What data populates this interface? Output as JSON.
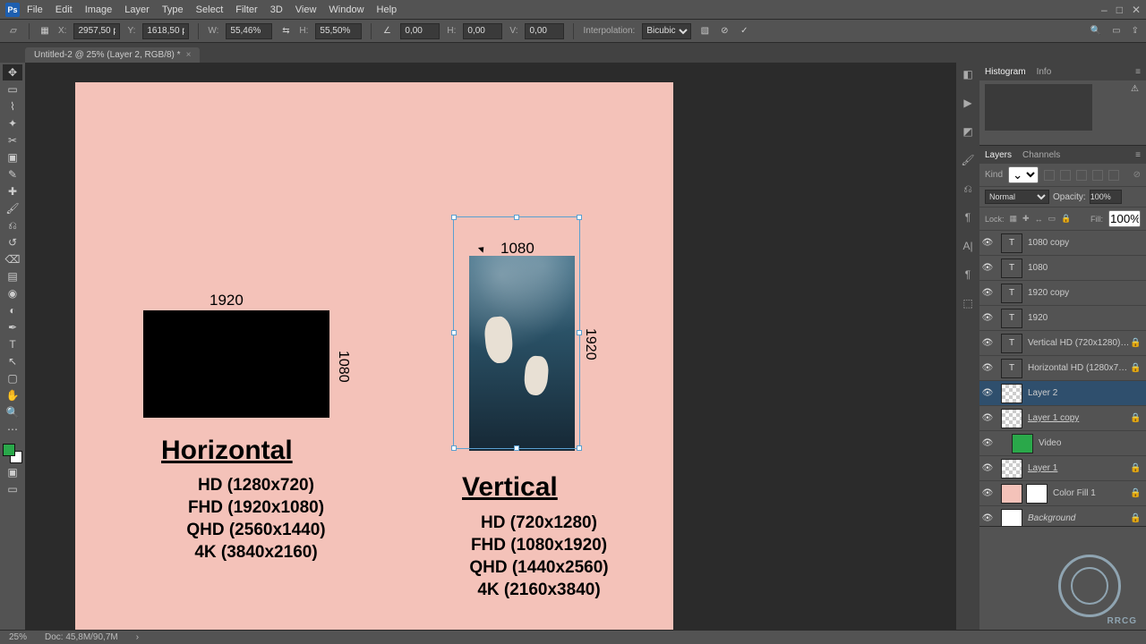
{
  "app_icon_text": "Ps",
  "menus": [
    "File",
    "Edit",
    "Image",
    "Layer",
    "Type",
    "Select",
    "Filter",
    "3D",
    "View",
    "Window",
    "Help"
  ],
  "window_controls": [
    "–",
    "□",
    "✕"
  ],
  "optbar": {
    "x_lbl": "X:",
    "x": "2957,50 p",
    "y_lbl": "Y:",
    "y": "1618,50 p",
    "w_lbl": "W:",
    "w": "55,46%",
    "h_lbl": "H:",
    "h": "55,50%",
    "rot_lbl": "",
    "rot": "0,00",
    "hskew_lbl": "H:",
    "hskew": "0,00",
    "vskew_lbl": "V:",
    "vskew": "0,00",
    "interp_lbl": "Interpolation:",
    "interp": "Bicubic"
  },
  "doc_tab": "Untitled-2 @ 25% (Layer 2, RGB/8) *",
  "canvas": {
    "horz": {
      "w": "1920",
      "h": "1080",
      "title": "Horizontal",
      "lines": [
        "HD (1280x720)",
        "FHD (1920x1080)",
        "QHD (2560x1440)",
        "4K (3840x2160)"
      ]
    },
    "vert": {
      "w": "1080",
      "h": "1920",
      "title": "Vertical",
      "lines": [
        "HD (720x1280)",
        "FHD (1080x1920)",
        "QHD (1440x2560)",
        "4K (2160x3840)"
      ]
    }
  },
  "panel_tabs": {
    "hist": [
      "Histogram",
      "Info"
    ],
    "layers": [
      "Layers",
      "Channels"
    ]
  },
  "layers": {
    "kind_lbl": "Kind",
    "blend": "Normal",
    "opacity_lbl": "Opacity:",
    "opacity": "100%",
    "lock_lbl": "Lock:",
    "fill_lbl": "Fill:",
    "fill": "100%",
    "items": [
      {
        "thumb": "T",
        "cls": "t-text",
        "name": "1080 copy",
        "lock": false
      },
      {
        "thumb": "T",
        "cls": "t-text",
        "name": "1080",
        "lock": false
      },
      {
        "thumb": "T",
        "cls": "t-text",
        "name": "1920 copy",
        "lock": false
      },
      {
        "thumb": "T",
        "cls": "t-text",
        "name": "1920",
        "lock": false
      },
      {
        "thumb": "T",
        "cls": "t-text",
        "name": "Vertical HD (720x1280) FHD (1...",
        "lock": true
      },
      {
        "thumb": "T",
        "cls": "t-text",
        "name": "Horizontal HD (1280x720) FHD ...",
        "lock": true
      },
      {
        "thumb": "",
        "cls": "t-check",
        "name": "Layer 2",
        "lock": false,
        "sel": true
      },
      {
        "thumb": "",
        "cls": "t-check",
        "name": "Layer 1 copy",
        "lock": true,
        "underline": true
      },
      {
        "thumb": "",
        "cls": "t-green",
        "name": "Video",
        "lock": false,
        "indent": true
      },
      {
        "thumb": "",
        "cls": "t-check",
        "name": "Layer 1",
        "lock": true,
        "underline": true
      },
      {
        "thumb": "",
        "cls": "t-rose",
        "name": "Color Fill 1",
        "lock": true,
        "mask": true
      },
      {
        "thumb": "",
        "cls": "t-white",
        "name": "Background",
        "lock": true,
        "italic": true
      }
    ]
  },
  "status": {
    "zoom": "25%",
    "doc": "Doc: 45,8M/90,7M"
  },
  "watermark": "RRCG"
}
